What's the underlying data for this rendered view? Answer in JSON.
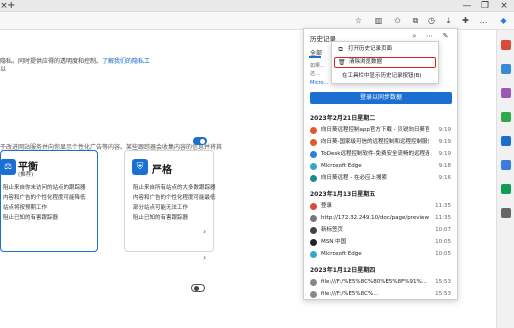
{
  "tabbar": {
    "close_glyph": "×",
    "new_tab_glyph": "+",
    "minimize_glyph": "—",
    "restore_glyph": "❐",
    "window_close_glyph": "×"
  },
  "page": {
    "privacy_text": "隐私。同时提供应得的透明度和控制。",
    "privacy_link": "了解我们的隐私工",
    "privacy_text2": "以",
    "tracking_desc": "于改进网站服务并向你显示个性化广告等内容。某些跟踪器会收集内容的信息并将其",
    "balanced": {
      "title": "平衡",
      "subtitle": "(推荐)",
      "items": [
        "阻止来自你未访问的站点的跟踪器",
        "内容和广告的个性化程度可能降低",
        "站点将按预期工作",
        "阻止已知的有害跟踪器"
      ]
    },
    "strict": {
      "title": "严格",
      "items": [
        "阻止来自所有站点的大多数跟踪器",
        "内容和广告的个性化程度可能最低",
        "部分站点可能无法工作",
        "阻止已知的有害跟踪器"
      ]
    }
  },
  "history": {
    "title": "历史记录",
    "tab_all": "全部",
    "note1": "如果...",
    "note2": "还...",
    "note3": "Micro...",
    "sync_button": "登录以同步数据",
    "menu": {
      "open_page": "打开历史记录页面",
      "clear_data": "清除浏览数据",
      "show_button": "在工具栏中显示历史记录按钮(B)"
    },
    "groups": [
      {
        "date": "2023年2月21日星期二",
        "items": [
          {
            "title": "向日葵远程控制app官方下载 - 贝锐向日葵官网",
            "time": "9:19"
          },
          {
            "title": "向日葵-国家级可信的远程控制和远程控制服务",
            "time": "9:19"
          },
          {
            "title": "ToDesk远程控制软件-免费安全流畅的远程连接",
            "time": "9:19"
          },
          {
            "title": "Microsoft Edge",
            "time": "9:18"
          },
          {
            "title": "向日葵远程 - 在必应上搜索",
            "time": "9:16"
          }
        ]
      },
      {
        "date": "2023年1月13日星期五",
        "items": [
          {
            "title": "登录",
            "time": "11:35"
          },
          {
            "title": "http://172.32.249.10/doc/page/preview.asp",
            "time": "11:35"
          },
          {
            "title": "新标签页",
            "time": "10:07"
          },
          {
            "title": "MSN 中国",
            "time": "10:05"
          },
          {
            "title": "Microsoft Edge",
            "time": "10:05"
          }
        ]
      },
      {
        "date": "2023年1月12日星期四",
        "items": [
          {
            "title": "file:///F:/%E5%8C%80%E5%8F%91%...",
            "time": "15:53"
          },
          {
            "title": "file:///F:/%E5%8C%...",
            "time": "15:53"
          }
        ]
      }
    ]
  }
}
